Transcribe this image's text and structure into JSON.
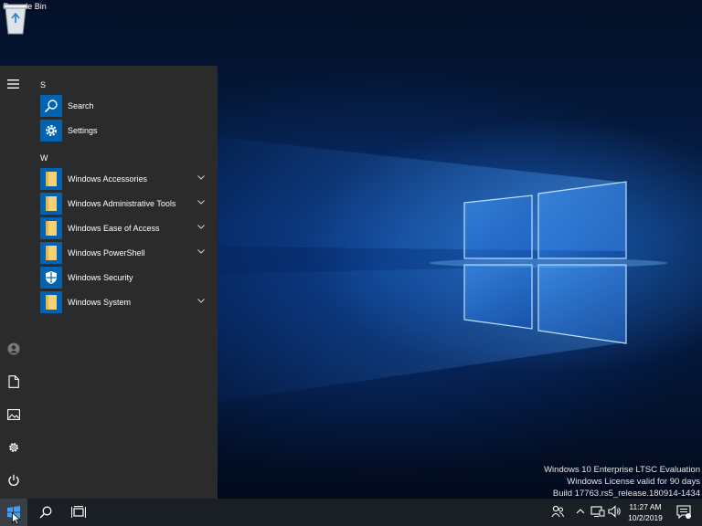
{
  "desktop": {
    "recycle_bin_label": "Recycle Bin",
    "watermark": {
      "line1": "Windows 10 Enterprise LTSC Evaluation",
      "line2": "Windows License valid for 90 days",
      "line3": "Build 17763.rs5_release.180914-1434"
    }
  },
  "start_menu": {
    "groups": [
      {
        "letter": "S",
        "apps": [
          {
            "label": "Search",
            "icon": "search-icon",
            "expandable": false
          },
          {
            "label": "Settings",
            "icon": "gear-icon",
            "expandable": false
          }
        ]
      },
      {
        "letter": "W",
        "apps": [
          {
            "label": "Windows Accessories",
            "icon": "folder-icon",
            "expandable": true
          },
          {
            "label": "Windows Administrative Tools",
            "icon": "folder-icon",
            "expandable": true
          },
          {
            "label": "Windows Ease of Access",
            "icon": "folder-icon",
            "expandable": true
          },
          {
            "label": "Windows PowerShell",
            "icon": "folder-icon",
            "expandable": true
          },
          {
            "label": "Windows Security",
            "icon": "shield-icon",
            "expandable": false
          },
          {
            "label": "Windows System",
            "icon": "folder-icon",
            "expandable": true
          }
        ]
      }
    ],
    "rail": [
      "hamburger-icon",
      "user-icon",
      "document-icon",
      "pictures-icon",
      "gear-icon",
      "power-icon"
    ]
  },
  "taskbar": {
    "time": "11:27 AM",
    "date": "10/2/2019"
  },
  "colors": {
    "accent": "#0063b1",
    "start_menu_bg": "#2b2b2b",
    "taskbar_bg": "#1a1f26"
  }
}
